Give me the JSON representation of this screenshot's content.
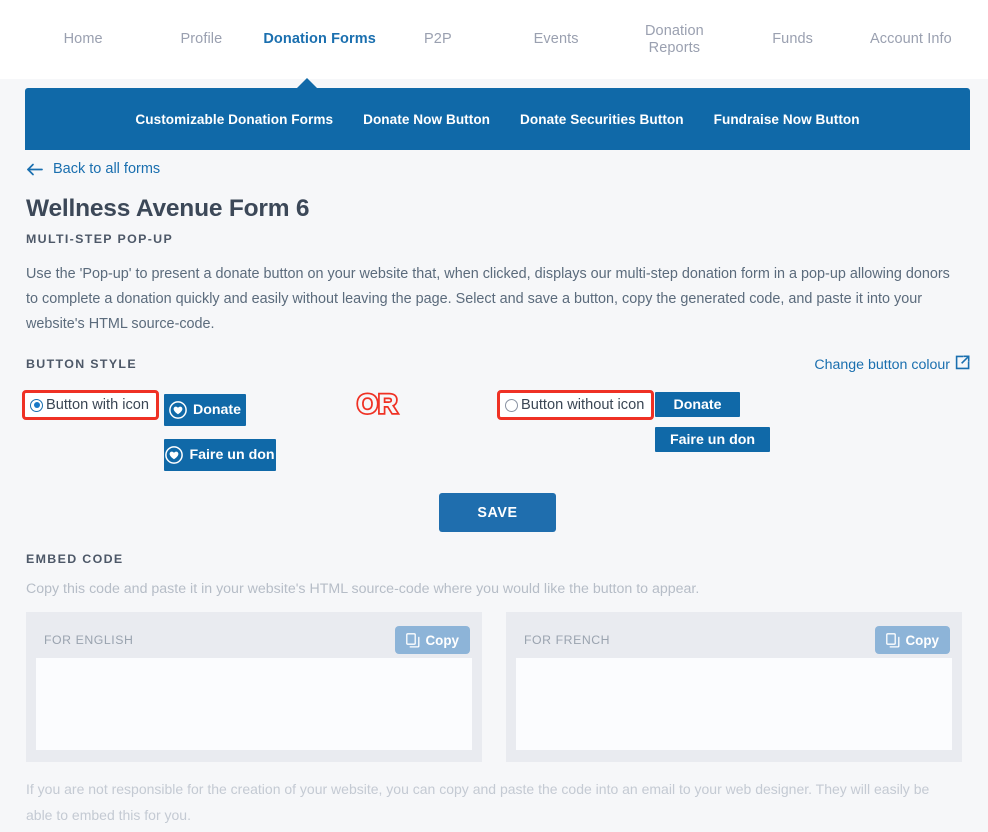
{
  "topnav": {
    "items": [
      {
        "label": "Home",
        "active": false
      },
      {
        "label": "Profile",
        "active": false
      },
      {
        "label": "Donation Forms",
        "active": true
      },
      {
        "label": "P2P",
        "active": false
      },
      {
        "label": "Events",
        "active": false
      },
      {
        "label": "Donation Reports",
        "active": false
      },
      {
        "label": "Funds",
        "active": false
      },
      {
        "label": "Account Info",
        "active": false
      }
    ]
  },
  "subnav": {
    "background_color": "#1069a8",
    "items": [
      {
        "label": "Customizable Donation Forms"
      },
      {
        "label": "Donate Now Button"
      },
      {
        "label": "Donate Securities Button"
      },
      {
        "label": "Fundraise Now Button"
      }
    ]
  },
  "page": {
    "back_link": "Back to all forms",
    "title": "Wellness Avenue Form 6",
    "subtitle": "MULTI-STEP POP-UP",
    "description": "Use the 'Pop-up' to present a donate button on your website that, when clicked, displays our multi-step donation form in a pop-up allowing donors to complete a donation quickly and easily without leaving the page. Select and save a button, copy the generated code, and paste it into your website's HTML source-code."
  },
  "button_style": {
    "section_label": "BUTTON STYLE",
    "change_colour_link": "Change button colour",
    "or_text": "OR",
    "with_icon": {
      "radio_label": "Button with icon",
      "selected": true,
      "buttons": [
        {
          "label": "Donate"
        },
        {
          "label": "Faire un don"
        }
      ]
    },
    "without_icon": {
      "radio_label": "Button without icon",
      "selected": false,
      "buttons": [
        {
          "label": "Donate"
        },
        {
          "label": "Faire un don"
        }
      ]
    },
    "accent_color": "#1069a8",
    "annotation_color": "#ef3124"
  },
  "save_button": {
    "label": "SAVE"
  },
  "embed": {
    "section_label": "EMBED CODE",
    "description": "Copy this code and paste it in your website's HTML source-code where you would like the button to appear.",
    "panels": [
      {
        "heading": "FOR ENGLISH",
        "copy_label": "Copy",
        "code": ""
      },
      {
        "heading": "FOR FRENCH",
        "copy_label": "Copy",
        "code": ""
      }
    ],
    "footer": "If you are not responsible for the creation of your website, you can copy and paste the code into an email to your web designer. They will easily be able to embed this for you."
  }
}
